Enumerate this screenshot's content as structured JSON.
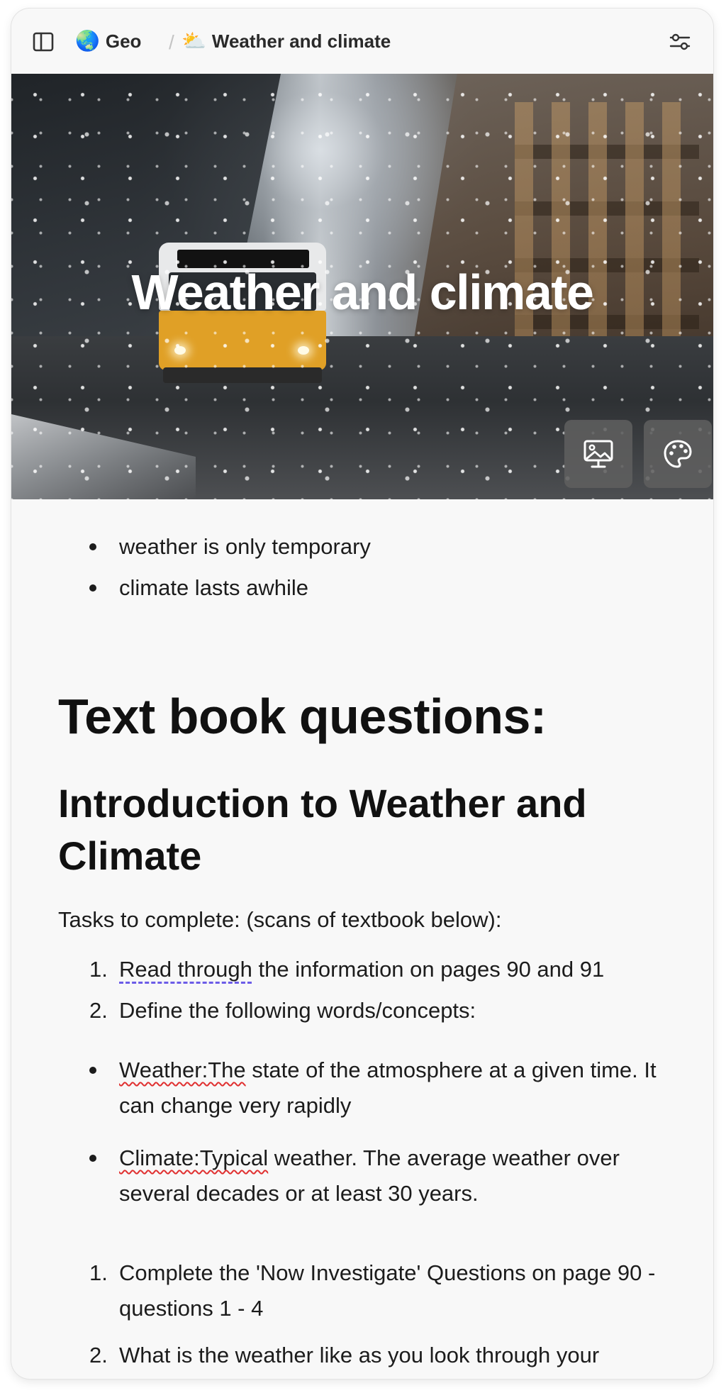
{
  "topbar": {
    "workspace_emoji": "🌏",
    "workspace_name": "Geo",
    "separator": "/",
    "page_emoji": "⛅",
    "page_name": "Weather and climate"
  },
  "cover": {
    "title": "Weather and climate",
    "buttons": [
      {
        "icon": "image-monitor-icon"
      },
      {
        "icon": "palette-icon"
      }
    ]
  },
  "content": {
    "intro_bullets": [
      "weather is only temporary",
      "climate lasts awhile"
    ],
    "heading1": "Text book questions:",
    "heading2": "Introduction to Weather and Climate",
    "tasks_intro": "Tasks to complete: (scans of textbook below):",
    "tasks": [
      {
        "num": "1.",
        "marked": "Read through",
        "rest": " the information on pages 90 and 91"
      },
      {
        "num": "2.",
        "marked": "",
        "rest": "Define the following words/concepts:"
      }
    ],
    "definitions": [
      {
        "marked": "Weather:The",
        "rest": " state of the atmosphere at a given time. It can change very rapidly"
      },
      {
        "marked": "Climate:Typical",
        "rest": " weather. The average weather over several decades or at least 30 years."
      }
    ],
    "tasks2": [
      {
        "num": "1.",
        "text": "Complete the 'Now Investigate' Questions on page 90 - questions 1 - 4"
      },
      {
        "num": "2.",
        "text": "What is the weather like as you look through your"
      }
    ]
  }
}
